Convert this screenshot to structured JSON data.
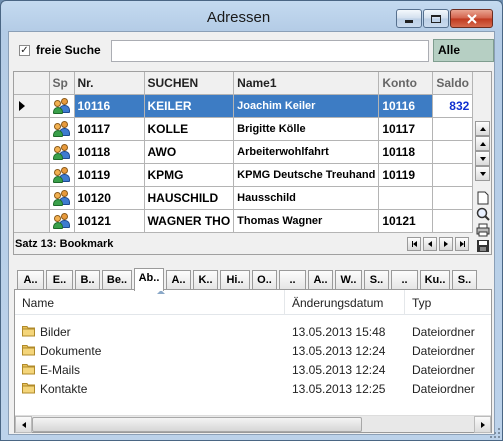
{
  "window": {
    "title": "Adressen"
  },
  "search": {
    "checkbox_label": "freie Suche",
    "value": "",
    "filter_label": "Alle"
  },
  "grid": {
    "columns": [
      "Sp",
      "Nr.",
      "SUCHEN",
      "Name1",
      "Konto",
      "Saldo"
    ],
    "rows": [
      {
        "nr": "10116",
        "suchen": "KEILER",
        "name1": "Joachim Keiler",
        "konto": "10116",
        "saldo": "832"
      },
      {
        "nr": "10117",
        "suchen": "KOLLE",
        "name1": "Brigitte Kölle",
        "konto": "10117",
        "saldo": ""
      },
      {
        "nr": "10118",
        "suchen": "AWO",
        "name1": "Arbeiterwohlfahrt",
        "konto": "10118",
        "saldo": ""
      },
      {
        "nr": "10119",
        "suchen": "KPMG",
        "name1": "KPMG Deutsche Treuhand",
        "konto": "10119",
        "saldo": ""
      },
      {
        "nr": "10120",
        "suchen": "HAUSCHILD",
        "name1": "Hausschild",
        "konto": "",
        "saldo": ""
      },
      {
        "nr": "10121",
        "suchen": "WAGNER THO",
        "name1": "Thomas Wagner",
        "konto": "10121",
        "saldo": ""
      }
    ],
    "status": "Satz 13: Bookmark"
  },
  "tabs": [
    "A..",
    "E..",
    "B..",
    "Be..",
    "Ab..",
    "A..",
    "K..",
    "Hi..",
    "O..",
    "..",
    "A..",
    "W..",
    "S..",
    "..",
    "Ku..",
    "S.."
  ],
  "explorer": {
    "headers": [
      "Name",
      "Änderungsdatum",
      "Typ"
    ],
    "rows": [
      {
        "name": "Bilder",
        "date": "13.05.2013 15:48",
        "type": "Dateiordner"
      },
      {
        "name": "Dokumente",
        "date": "13.05.2013 12:24",
        "type": "Dateiordner"
      },
      {
        "name": "E-Mails",
        "date": "13.05.2013 12:24",
        "type": "Dateiordner"
      },
      {
        "name": "Kontakte",
        "date": "13.05.2013 12:25",
        "type": "Dateiordner"
      }
    ]
  },
  "colors": {
    "selection": "#3d7cc4",
    "filter_bg": "#b6cfc3",
    "saldo_text": "#1030d0",
    "folder": "#e8c25a"
  }
}
